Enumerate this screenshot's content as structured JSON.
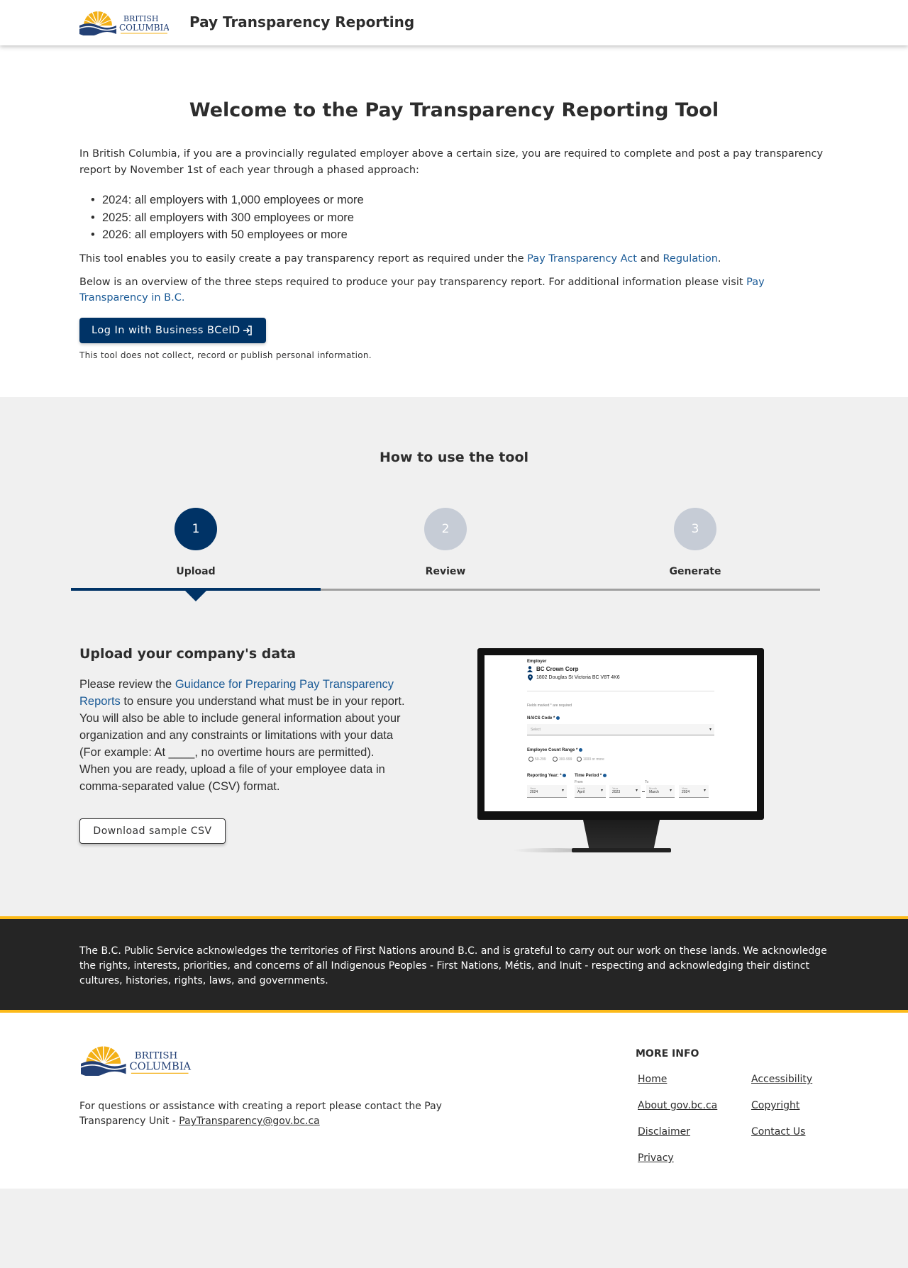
{
  "header": {
    "logo_line1": "BRITISH",
    "logo_line2": "COLUMBIA",
    "app_title": "Pay Transparency Reporting"
  },
  "intro": {
    "heading": "Welcome to the Pay Transparency Reporting Tool",
    "paragraph1": "In British Columbia, if you are a provincially regulated employer above a certain size, you are required to complete and post a pay transparency report by November 1st of each year through a phased approach:",
    "phases": [
      "2024: all employers with 1,000 employees or more",
      "2025: all employers with 300 employees or more",
      "2026: all employers with 50 employees or more"
    ],
    "p2_before": "This tool enables you to easily create a pay transparency report as required under the ",
    "p2_link1": "Pay Transparency Act",
    "p2_middle": " and ",
    "p2_link2": "Regulation",
    "p2_after": ".",
    "p3_before": "Below is an overview of the three steps required to produce your pay transparency report. For additional information please visit ",
    "p3_link": "Pay Transparency in B.C.",
    "p3_after": "",
    "login_button": "Log In with Business BCeID",
    "privacy_note": "This tool does not collect, record or publish personal information."
  },
  "howto": {
    "heading": "How to use the tool",
    "steps": [
      {
        "number": "1",
        "label": "Upload"
      },
      {
        "number": "2",
        "label": "Review"
      },
      {
        "number": "3",
        "label": "Generate"
      }
    ],
    "active_step": 1,
    "section_title": "Upload your company's data",
    "desc_before": "Please review the ",
    "desc_link": "Guidance for Preparing Pay Transparency Reports",
    "desc_after": " to ensure you understand what must be in your report. You will also be able to include general information about your organization and any constraints or limitations with your data (For example: At ____, no overtime hours are permitted). When you are ready, upload a file of your employee data in comma-separated value (CSV) format.",
    "download_button": "Download sample CSV"
  },
  "preview": {
    "employer_label": "Employer",
    "company": "BC Crown Corp",
    "address": "1802 Douglas St Victoria BC V8T 4K6",
    "required_note": "Fields marked * are required",
    "naics_label": "NAICS Code *",
    "naics_placeholder": "Select",
    "employee_range_label": "Employee Count Range *",
    "ranges": [
      "50-299",
      "300-999",
      "1000 or more"
    ],
    "reporting_year_label": "Reporting Year: *",
    "time_period_label": "Time Period *",
    "from_label": "From",
    "to_label": "To",
    "year_label": "Year",
    "month_label": "Month",
    "year_value": "2024",
    "from_month": "April",
    "from_year": "2023",
    "to_month": "March",
    "to_year": "2024"
  },
  "acknowledgement": "The B.C. Public Service acknowledges the territories of First Nations around B.C. and is grateful to carry out our work on these lands. We acknowledge the rights, interests, priorities, and concerns of all Indigenous Peoples - First Nations, Métis, and Inuit - respecting and acknowledging their distinct cultures, histories, rights, laws, and governments.",
  "footer": {
    "contact_text": "For questions or assistance with creating a report please contact the Pay Transparency Unit - ",
    "contact_email": "PayTransparency@gov.bc.ca",
    "more_info_heading": "MORE INFO",
    "links": [
      "Home",
      "Accessibility",
      "About gov.bc.ca",
      "Copyright",
      "Disclaimer",
      "Contact Us",
      "Privacy"
    ]
  },
  "colors": {
    "primary": "#003366",
    "link": "#1a5a96",
    "gold": "#fcba19",
    "inactive_step": "#c6ccd6"
  }
}
